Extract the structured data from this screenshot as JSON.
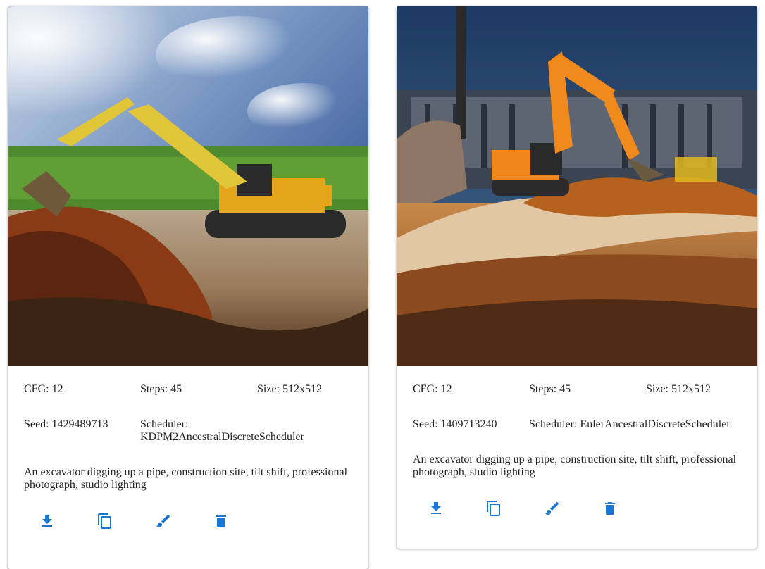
{
  "accent_color": "#1976d2",
  "cards": [
    {
      "image_alt": "excavator-photo-1",
      "cfg": "CFG: 12",
      "steps": "Steps: 45",
      "size": "Size: 512x512",
      "seed": "Seed: 1429489713",
      "scheduler_label": "Scheduler:",
      "scheduler_value": "KDPM2AncestralDiscreteScheduler",
      "prompt": "An excavator digging up a pipe, construction site, tilt shift, professional photograph, studio lighting",
      "actions": [
        "download-icon",
        "copy-icon",
        "brush-icon",
        "delete-icon"
      ]
    },
    {
      "image_alt": "excavator-photo-2",
      "cfg": "CFG: 12",
      "steps": "Steps: 45",
      "size": "Size: 512x512",
      "seed": "Seed: 1409713240",
      "scheduler": "Scheduler: EulerAncestralDiscreteScheduler",
      "prompt": "An excavator digging up a pipe, construction site, tilt shift, professional photograph, studio lighting",
      "actions": [
        "download-icon",
        "copy-icon",
        "brush-icon",
        "delete-icon"
      ]
    }
  ]
}
